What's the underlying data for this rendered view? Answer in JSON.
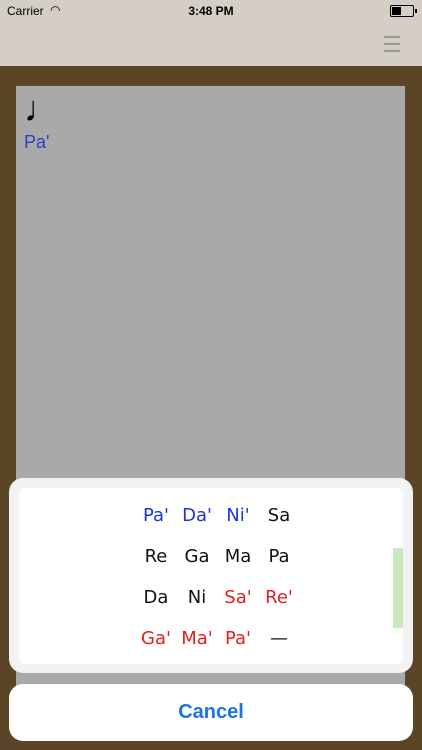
{
  "status_bar": {
    "carrier": "Carrier",
    "time": "3:48 PM",
    "wifi_icon": "wifi-icon",
    "battery_icon": "battery-icon"
  },
  "nav": {
    "menu_icon": "hamburger-menu-icon",
    "menu_glyph": "☰"
  },
  "sheet": {
    "note_glyph": "♩",
    "note_text": "Pa'"
  },
  "picker": {
    "rows": [
      [
        {
          "label": "Pa'",
          "color": "blue"
        },
        {
          "label": "Da'",
          "color": "blue"
        },
        {
          "label": "Ni'",
          "color": "blue"
        },
        {
          "label": "Sa",
          "color": "black"
        }
      ],
      [
        {
          "label": "Re",
          "color": "black"
        },
        {
          "label": "Ga",
          "color": "black"
        },
        {
          "label": "Ma",
          "color": "black"
        },
        {
          "label": "Pa",
          "color": "black"
        }
      ],
      [
        {
          "label": "Da",
          "color": "black"
        },
        {
          "label": "Ni",
          "color": "black"
        },
        {
          "label": "Sa'",
          "color": "red"
        },
        {
          "label": "Re'",
          "color": "red"
        }
      ],
      [
        {
          "label": "Ga'",
          "color": "red"
        },
        {
          "label": "Ma'",
          "color": "red"
        },
        {
          "label": "Pa'",
          "color": "red"
        },
        {
          "label": "—",
          "color": "black"
        }
      ]
    ]
  },
  "cancel": {
    "label": "Cancel"
  }
}
